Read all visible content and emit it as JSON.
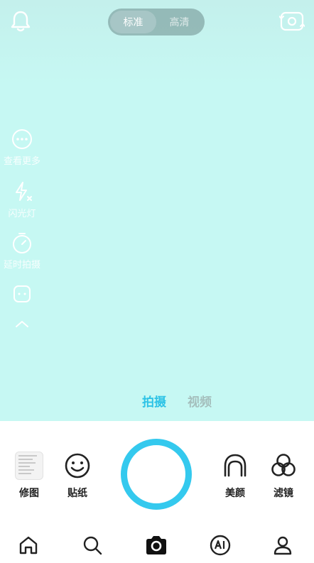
{
  "header": {
    "quality_options": [
      "标准",
      "高清"
    ],
    "quality_selected": "标准",
    "bell_icon": "bell-icon",
    "flip_icon": "flip-camera-icon"
  },
  "side_tools": [
    {
      "label": "查看更多",
      "icon": "more-icon"
    },
    {
      "label": "闪光灯",
      "icon": "flash-off-icon"
    },
    {
      "label": "延时拍摄",
      "icon": "timer-icon"
    },
    {
      "label": "",
      "icon": "ratio-icon"
    },
    {
      "label": "",
      "icon": "chevron-up-icon"
    }
  ],
  "modes": [
    "拍摄",
    "视频"
  ],
  "mode_selected": "拍摄",
  "actions": {
    "edit_label": "修图",
    "sticker_label": "贴纸",
    "beauty_label": "美颜",
    "filter_label": "滤镜"
  },
  "nav": [
    "home-icon",
    "search-icon",
    "camera-icon",
    "ai-icon",
    "profile-icon"
  ],
  "colors": {
    "viewfinder": "#c6f8f3",
    "accent": "#34c9ee",
    "text": "#222222"
  }
}
